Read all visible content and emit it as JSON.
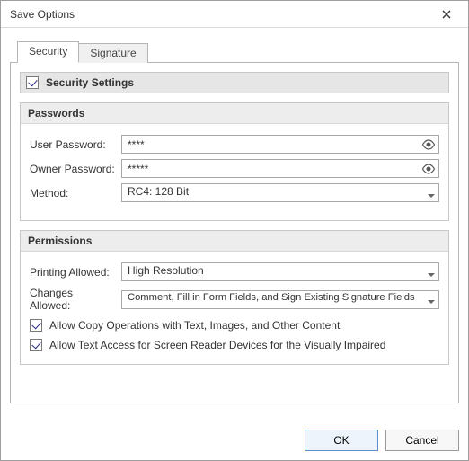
{
  "window": {
    "title": "Save Options"
  },
  "tabs": {
    "security": "Security",
    "signature": "Signature"
  },
  "security": {
    "heading": "Security Settings",
    "enabled": true,
    "passwords": {
      "title": "Passwords",
      "user_label": "User Password:",
      "user_value": "****",
      "owner_label": "Owner Password:",
      "owner_value": "*****",
      "method_label": "Method:",
      "method_value": "RC4: 128 Bit"
    },
    "permissions": {
      "title": "Permissions",
      "printing_label": "Printing Allowed:",
      "printing_value": "High Resolution",
      "changes_label": "Changes Allowed:",
      "changes_value": "Comment, Fill in Form Fields, and Sign Existing Signature Fields",
      "allow_copy": "Allow Copy Operations with Text, Images, and Other Content",
      "allow_text_access": "Allow Text Access for Screen Reader Devices for the Visually Impaired"
    }
  },
  "buttons": {
    "ok": "OK",
    "cancel": "Cancel"
  }
}
